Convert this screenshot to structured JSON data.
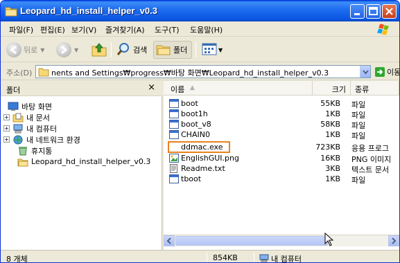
{
  "window": {
    "title": "Leopard_hd_install_helper_v0.3"
  },
  "menu": [
    "파일(F)",
    "편집(E)",
    "보기(V)",
    "즐겨찾기(A)",
    "도구(T)",
    "도움말(H)"
  ],
  "toolbar": {
    "back_label": "뒤로",
    "search_label": "검색",
    "folders_label": "폴더"
  },
  "address": {
    "label": "주소(D)",
    "value": "nents and Settings₩progress₩바탕 화면₩Leopard_hd_install_helper_v0.3",
    "go_label": "이동"
  },
  "folder_pane": {
    "title": "폴더",
    "close": "×",
    "items": [
      {
        "label": "바탕 화면",
        "icon": "desktop-icon",
        "expander": ""
      },
      {
        "label": "내 문서",
        "icon": "my-documents-icon",
        "expander": "+"
      },
      {
        "label": "내 컴퓨터",
        "icon": "my-computer-icon",
        "expander": "+"
      },
      {
        "label": "내 네트워크 환경",
        "icon": "network-icon",
        "expander": "+"
      },
      {
        "label": "휴지통",
        "icon": "recycle-bin-icon",
        "expander": ""
      },
      {
        "label": "Leopard_hd_install_helper_v0.3",
        "icon": "folder-icon",
        "expander": ""
      }
    ]
  },
  "file_list": {
    "columns": {
      "name": "이름",
      "size": "크기",
      "type": "종류"
    },
    "files": [
      {
        "name": "boot",
        "size": "55KB",
        "type": "파일",
        "icon": "file-icon"
      },
      {
        "name": "boot1h",
        "size": "1KB",
        "type": "파일",
        "icon": "file-icon"
      },
      {
        "name": "boot_v8",
        "size": "58KB",
        "type": "파일",
        "icon": "file-icon"
      },
      {
        "name": "CHAIN0",
        "size": "1KB",
        "type": "파일",
        "icon": "file-icon"
      },
      {
        "name": "ddmac.exe",
        "size": "723KB",
        "type": "응용 프로그",
        "icon": "blank-icon"
      },
      {
        "name": "EnglishGUI.png",
        "size": "16KB",
        "type": "PNG 이미지",
        "icon": "image-icon"
      },
      {
        "name": "Readme.txt",
        "size": "3KB",
        "type": "텍스트 문서",
        "icon": "text-file-icon"
      },
      {
        "name": "tboot",
        "size": "1KB",
        "type": "파일",
        "icon": "file-icon"
      }
    ],
    "highlight_color": "#e8821e"
  },
  "status": {
    "count": "8 개체",
    "size": "854KB",
    "location": "내 컴퓨터"
  },
  "colors": {
    "titlebar": "#1f6ef0",
    "chrome": "#ece9d8",
    "highlight": "#e8821e"
  }
}
